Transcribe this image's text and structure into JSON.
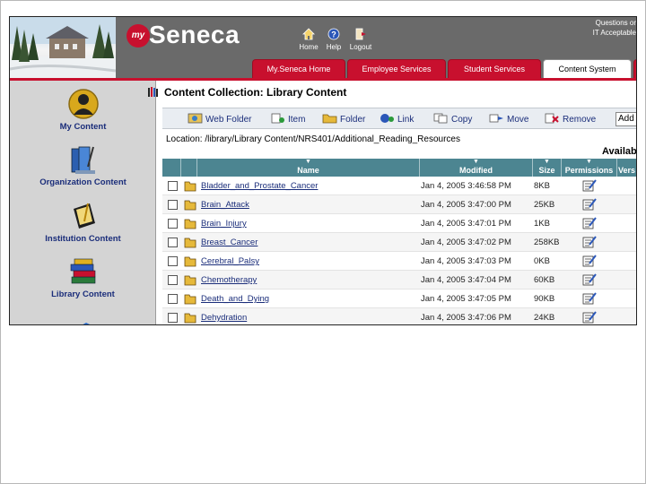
{
  "brand": {
    "badge": "my",
    "name": "Seneca"
  },
  "top_nav": [
    {
      "label": "Home",
      "icon": "home-icon"
    },
    {
      "label": "Help",
      "icon": "help-icon"
    },
    {
      "label": "Logout",
      "icon": "logout-icon"
    }
  ],
  "header_note": {
    "line1": "Questions or",
    "line2": "IT Acceptable"
  },
  "tabs": [
    {
      "label": "My.Seneca Home",
      "active": false
    },
    {
      "label": "Employee Services",
      "active": false
    },
    {
      "label": "Student Services",
      "active": false
    },
    {
      "label": "Content System",
      "active": true
    }
  ],
  "sidebar": {
    "items": [
      {
        "label": "My Content",
        "icon": "person-icon"
      },
      {
        "label": "Organization Content",
        "icon": "books-pen-icon"
      },
      {
        "label": "Institution Content",
        "icon": "notepad-icon"
      },
      {
        "label": "Library Content",
        "icon": "book-stack-icon"
      }
    ]
  },
  "main": {
    "title": "Content Collection: Library Content",
    "toolbar": {
      "web_folder": "Web Folder",
      "item": "Item",
      "folder": "Folder",
      "link": "Link",
      "copy": "Copy",
      "move": "Move",
      "remove": "Remove",
      "add_select": "Add"
    },
    "location": "Location: /library/Library Content/NRS401/Additional_Reading_Resources",
    "available": "Available",
    "columns": [
      "Name",
      "Modified",
      "Size",
      "Permissions",
      "Vers"
    ],
    "rows": [
      {
        "name": "Bladder_and_Prostate_Cancer",
        "modified": "Jan 4, 2005 3:46:58 PM",
        "size": "8KB"
      },
      {
        "name": "Brain_Attack",
        "modified": "Jan 4, 2005 3:47:00 PM",
        "size": "25KB"
      },
      {
        "name": "Brain_Injury",
        "modified": "Jan 4, 2005 3:47:01 PM",
        "size": "1KB"
      },
      {
        "name": "Breast_Cancer",
        "modified": "Jan 4, 2005 3:47:02 PM",
        "size": "258KB"
      },
      {
        "name": "Cerebral_Palsy",
        "modified": "Jan 4, 2005 3:47:03 PM",
        "size": "0KB"
      },
      {
        "name": "Chemotherapy",
        "modified": "Jan 4, 2005 3:47:04 PM",
        "size": "60KB"
      },
      {
        "name": "Death_and_Dying",
        "modified": "Jan 4, 2005 3:47:05 PM",
        "size": "90KB"
      },
      {
        "name": "Dehydration",
        "modified": "Jan 4, 2005 3:47:06 PM",
        "size": "24KB"
      }
    ]
  },
  "colors": {
    "brand_red": "#c8102e",
    "header_gray": "#6a6a6a",
    "table_header": "#4c8591",
    "link_blue": "#1a2d7a"
  }
}
